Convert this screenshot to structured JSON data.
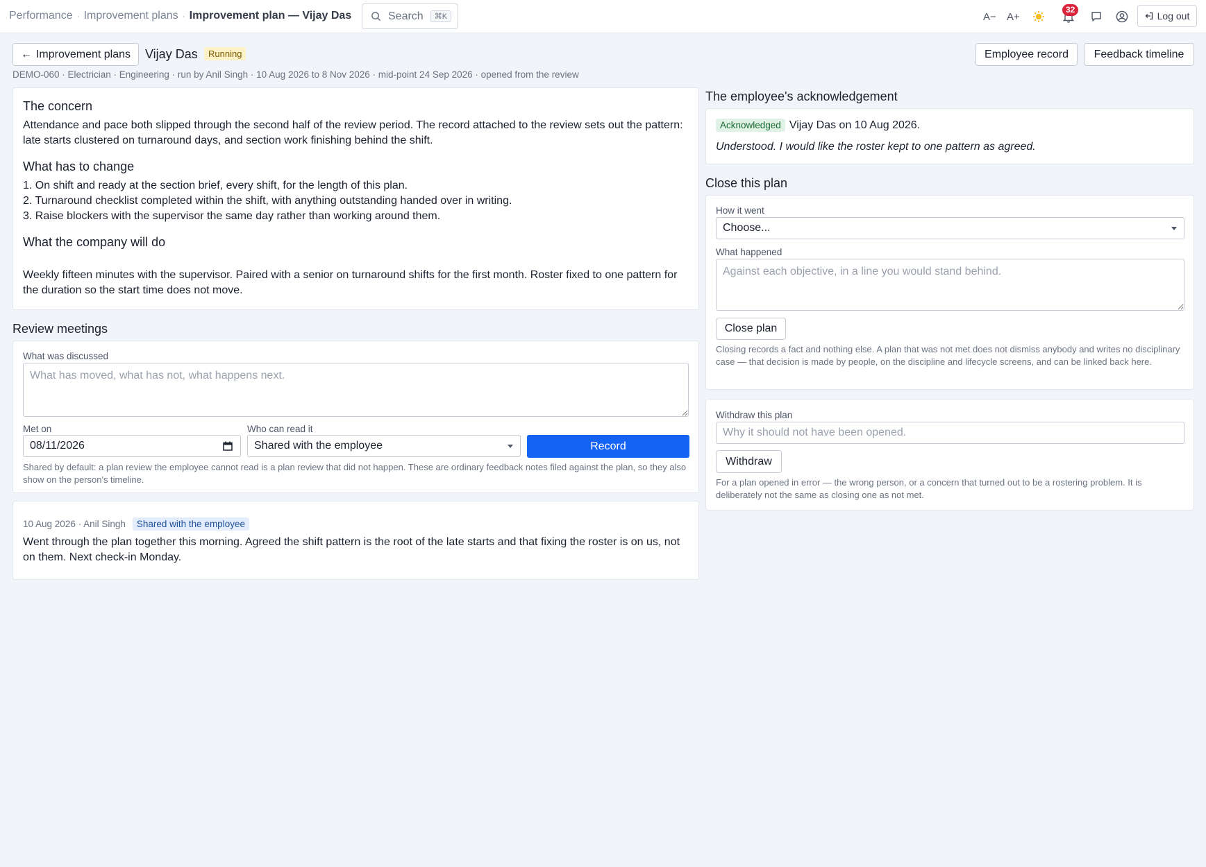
{
  "topbar": {
    "breadcrumbs": [
      "Performance",
      "Improvement plans",
      "Improvement plan — Vijay Das"
    ],
    "search": {
      "label": "Search",
      "shortcut": "⌘K"
    },
    "font_decrease": "A−",
    "font_increase": "A+",
    "notification_count": "32",
    "logout_label": "Log out"
  },
  "header": {
    "back_label": "Improvement plans",
    "person_name": "Vijay Das",
    "status": "Running",
    "employee_record_label": "Employee record",
    "feedback_timeline_label": "Feedback timeline",
    "meta": "DEMO-060 · Electrician · Engineering · run by Anil Singh · 10 Aug 2026 to 8 Nov 2026 · mid-point 24 Sep 2026 · opened from the review"
  },
  "plan": {
    "concern_title": "The concern",
    "concern_text": "Attendance and pace both slipped through the second half of the review period. The record attached to the review sets out the pattern: late starts clustered on turnaround days, and section work finishing behind the shift.",
    "change_title": "What has to change",
    "change_items": [
      "1. On shift and ready at the section brief, every shift, for the length of this plan.",
      "2. Turnaround checklist completed within the shift, with anything outstanding handed over in writing.",
      "3. Raise blockers with the supervisor the same day rather than working around them."
    ],
    "company_title": "What the company will do",
    "company_text": "Weekly fifteen minutes with the supervisor. Paired with a senior on turnaround shifts for the first month. Roster fixed to one pattern for the duration so the start time does not move."
  },
  "review": {
    "title": "Review meetings",
    "discussed_label": "What was discussed",
    "discussed_placeholder": "What has moved, what has not, what happens next.",
    "met_on_label": "Met on",
    "met_on_value": "08/11/2026",
    "who_label": "Who can read it",
    "who_value": "Shared with the employee",
    "record_label": "Record",
    "help": "Shared by default: a plan review the employee cannot read is a plan review that did not happen. These are ordinary feedback notes filed against the plan, so they also show on the person's timeline."
  },
  "meeting": {
    "meta": "10 Aug 2026 · Anil Singh",
    "tag": "Shared with the employee",
    "text": "Went through the plan together this morning. Agreed the shift pattern is the root of the late starts and that fixing the roster is on us, not on them. Next check-in Monday."
  },
  "acknowledgement": {
    "title": "The employee's acknowledgement",
    "tag": "Acknowledged",
    "by": "Vijay Das on 10 Aug 2026.",
    "quote": "Understood. I would like the roster kept to one pattern as agreed."
  },
  "close": {
    "title": "Close this plan",
    "how_label": "How it went",
    "how_value": "Choose...",
    "what_label": "What happened",
    "what_placeholder": "Against each objective, in a line you would stand behind.",
    "button": "Close plan",
    "help": "Closing records a fact and nothing else. A plan that was not met does not dismiss anybody and writes no disciplinary case — that decision is made by people, on the discipline and lifecycle screens, and can be linked back here."
  },
  "withdraw": {
    "label": "Withdraw this plan",
    "placeholder": "Why it should not have been opened.",
    "button": "Withdraw",
    "help": "For a plan opened in error — the wrong person, or a concern that turned out to be a rostering problem. It is deliberately not the same as closing one as not met."
  },
  "colors": {
    "primary": "#1463f3",
    "running_bg": "#fdf1c7",
    "ack_bg": "#e0f2e5",
    "shared_bg": "#e3edfb",
    "badge": "#d9233a"
  }
}
